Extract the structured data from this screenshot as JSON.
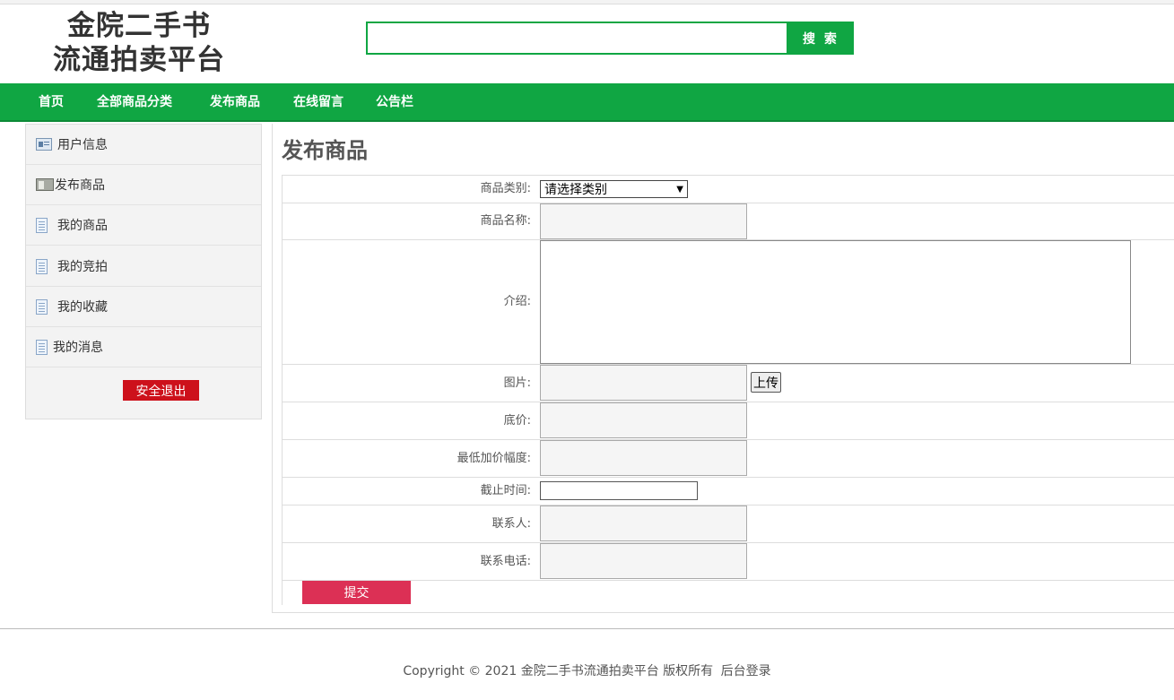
{
  "logo": {
    "line1": "金院二手书",
    "line2": "流通拍卖平台"
  },
  "search": {
    "value": "",
    "placeholder": "",
    "button": "搜 索"
  },
  "nav": {
    "items": [
      "首页",
      "全部商品分类",
      "发布商品",
      "在线留言",
      "公告栏"
    ]
  },
  "sidebar": {
    "items": [
      {
        "label": "用户信息",
        "icon": "user-card-icon"
      },
      {
        "label": "发布商品",
        "icon": "phone-icon"
      },
      {
        "label": "我的商品",
        "icon": "document-icon"
      },
      {
        "label": "我的竞拍",
        "icon": "document-icon"
      },
      {
        "label": "我的收藏",
        "icon": "document-icon"
      },
      {
        "label": "我的消息",
        "icon": "document-icon"
      }
    ],
    "logout": "安全退出"
  },
  "main": {
    "title": "发布商品",
    "form": {
      "category_label": "商品类别:",
      "category_selected": "请选择类别",
      "name_label": "商品名称:",
      "intro_label": "介绍:",
      "image_label": "图片:",
      "upload_button": "上传",
      "base_price_label": "底价:",
      "min_increment_label": "最低加价幅度:",
      "deadline_label": "截止时间:",
      "contact_label": "联系人:",
      "phone_label": "联系电话:",
      "submit": "提交"
    }
  },
  "footer": {
    "copyright": "Copyright © 2021 金院二手书流通拍卖平台 版权所有",
    "admin_link": "后台登录"
  },
  "colors": {
    "brand_green": "#10a643",
    "logout_red": "#cd111b",
    "submit_pink": "#dc3055"
  }
}
